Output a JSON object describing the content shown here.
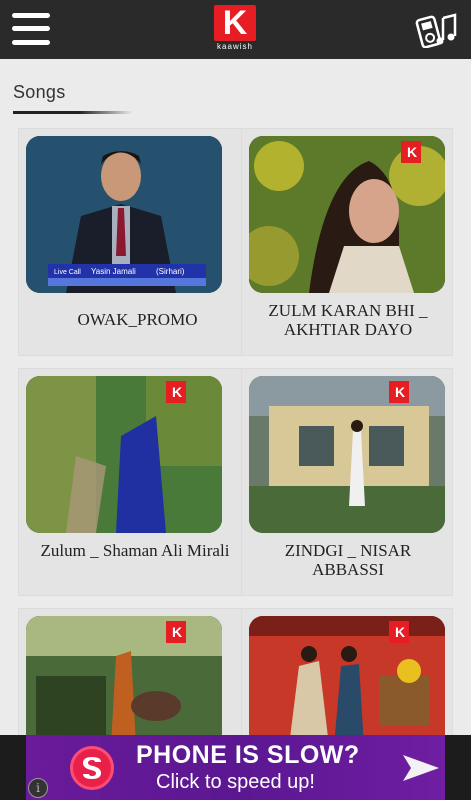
{
  "app": {
    "logo_letter": "K",
    "logo_tag": "kaawish",
    "section_title": "Songs"
  },
  "icons": {
    "menu": "hamburger-menu-icon",
    "music": "music-player-icon",
    "info": "info-icon"
  },
  "songs": [
    {
      "title": "OWAK_PROMO"
    },
    {
      "title": "ZULM KARAN BHI _ AKHTIAR DAYO"
    },
    {
      "title": "Zulum _ Shaman Ali Mirali"
    },
    {
      "title": "ZINDGI _ NISAR ABBASSI"
    },
    {
      "title": ""
    },
    {
      "title": ""
    }
  ],
  "ad": {
    "title": "PHONE IS SLOW?",
    "subtitle": "Click to speed up!",
    "info_symbol": "i"
  },
  "colors": {
    "topbar": "#2a2a2a",
    "brand_red": "#e61e24",
    "background": "#ebebeb",
    "ad_purple": "#5b1791"
  }
}
